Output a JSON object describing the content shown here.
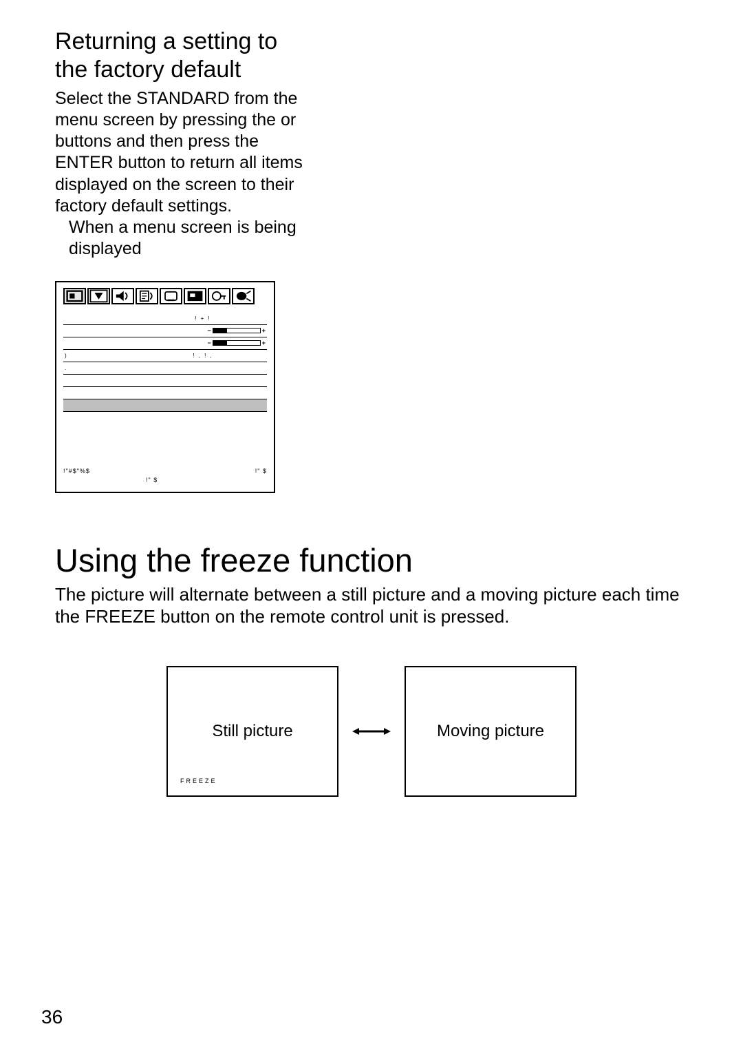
{
  "section1": {
    "title_line1": "Returning a setting to",
    "title_line2": "the factory default",
    "body": "Select the STANDARD from the menu screen by pressing the     or     buttons and then press the ENTER button to return all items displayed on the screen to their factory default settings.",
    "note": "When a menu screen is being displayed"
  },
  "menu": {
    "icons": [
      {
        "name": "picture-icon"
      },
      {
        "name": "position-icon"
      },
      {
        "name": "audio-icon"
      },
      {
        "name": "language-icon"
      },
      {
        "name": "option1-icon"
      },
      {
        "name": "option2-icon"
      },
      {
        "name": "security-icon"
      },
      {
        "name": "network-icon"
      }
    ],
    "rows": [
      {
        "label": "",
        "value_text": "!   +   !",
        "type": "text"
      },
      {
        "label": "",
        "fill": 30,
        "type": "slider"
      },
      {
        "label": "",
        "fill": 30,
        "type": "slider"
      },
      {
        "label": ")",
        "value_text": "!  ,   !  ,",
        "type": "text"
      },
      {
        "label": ".",
        "value_text": "",
        "type": "text"
      },
      {
        "label": "",
        "value_text": "",
        "type": "text"
      },
      {
        "label": "",
        "value_text": "",
        "type": "text"
      },
      {
        "label": "",
        "value_text": "",
        "type": "highlight"
      }
    ],
    "footer_left": "!\"#$\"%$",
    "footer_right_symbols": "!\"    $",
    "footer_right_symbols2": "!\"   $"
  },
  "section2": {
    "heading": "Using the freeze function",
    "body": "The picture will alternate between a still picture and a moving picture each time the FREEZE button on the remote control unit is pressed."
  },
  "diagram": {
    "left_label": "Still picture",
    "right_label": "Moving picture",
    "freeze_tag": "FREEZE"
  },
  "page_number": "36"
}
